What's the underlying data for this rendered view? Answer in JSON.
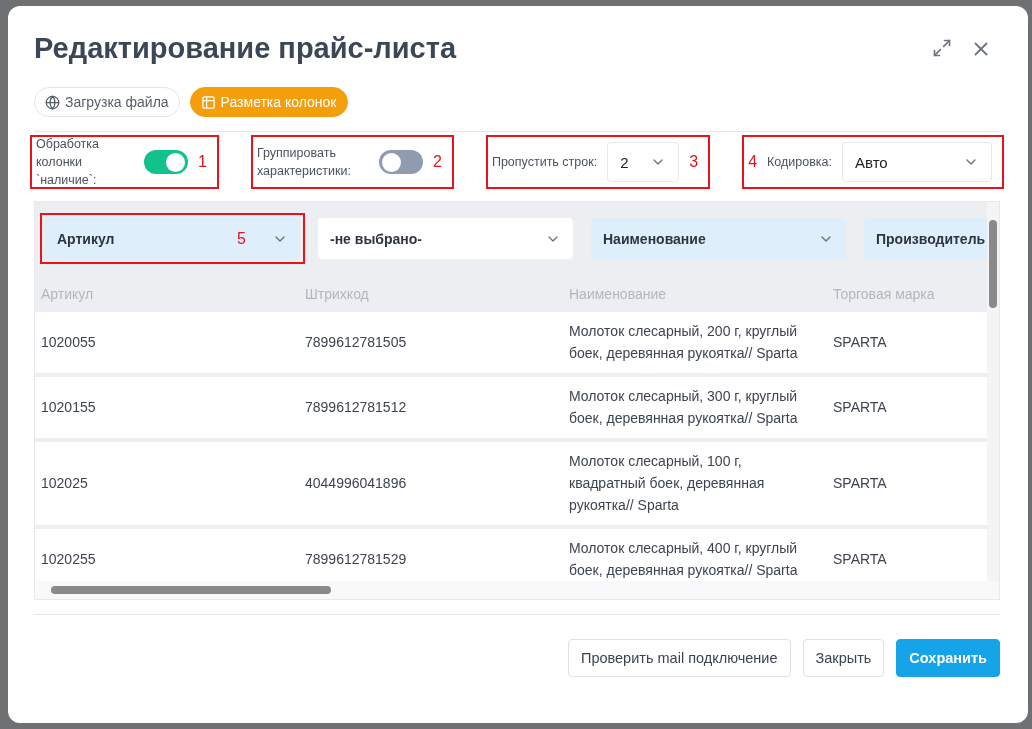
{
  "dialog": {
    "title": "Редактирование прайс-листа"
  },
  "tabs": [
    {
      "label": "Загрузка файла",
      "selected": false
    },
    {
      "label": "Разметка колонок",
      "selected": true
    }
  ],
  "options": [
    {
      "kind": "toggle",
      "label": "Обработка колонки `наличие`:",
      "on": true,
      "annotation": "1"
    },
    {
      "kind": "toggle",
      "label": "Группировать характеристики:",
      "on": false,
      "annotation": "2"
    },
    {
      "kind": "select",
      "label": "Пропустить строк:",
      "value": "2",
      "annotation": "3"
    },
    {
      "kind": "select",
      "label": "Кодировка:",
      "value": "Авто",
      "annotation": "4"
    }
  ],
  "table": {
    "column_mappings": [
      {
        "value": "Артикул",
        "mapped": true,
        "annotation": "5"
      },
      {
        "value": "-не выбрано-",
        "mapped": false
      },
      {
        "value": "Наименование",
        "mapped": true
      },
      {
        "value": "Производитель",
        "mapped": true
      }
    ],
    "headers": [
      "Артикул",
      "Штрихкод",
      "Наименование",
      "Торговая марка"
    ],
    "rows": [
      [
        "1020055",
        "7899612781505",
        "Молоток слесарный, 200 г, круглый боек, деревянная рукоятка// Sparta",
        "SPARTA"
      ],
      [
        "1020155",
        "7899612781512",
        "Молоток слесарный, 300 г, круглый боек, деревянная рукоятка// Sparta",
        "SPARTA"
      ],
      [
        "102025",
        "4044996041896",
        "Молоток слесарный, 100 г, квадратный боек, деревянная рукоятка// Sparta",
        "SPARTA"
      ],
      [
        "1020255",
        "7899612781529",
        "Молоток слесарный, 400 г, круглый боек, деревянная рукоятка// Sparta",
        "SPARTA"
      ]
    ]
  },
  "buttons": [
    {
      "label": "Проверить mail подключение",
      "kind": "secondary"
    },
    {
      "label": "Закрыть",
      "kind": "secondary"
    },
    {
      "label": "Сохранить",
      "kind": "primary"
    }
  ]
}
